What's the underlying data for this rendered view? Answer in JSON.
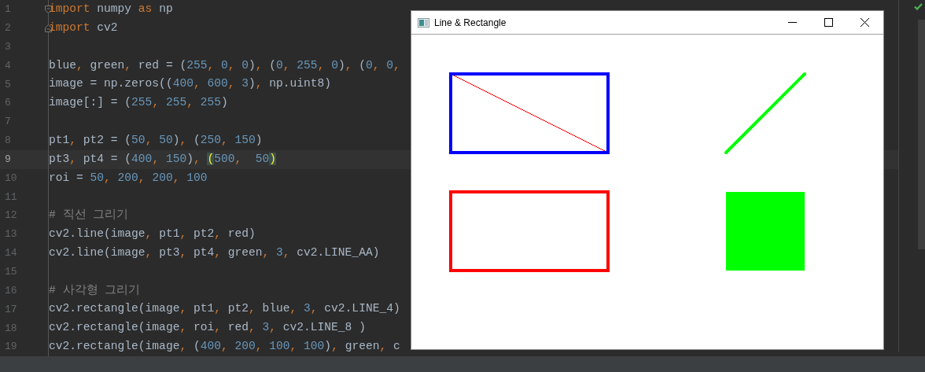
{
  "editor": {
    "lines": [
      {
        "number": "1",
        "fold_start": true,
        "tokens": [
          {
            "text": "import",
            "kind": "kw"
          },
          {
            "text": " numpy ",
            "kind": "p"
          },
          {
            "text": "as",
            "kind": "kw"
          },
          {
            "text": " np",
            "kind": "p"
          }
        ]
      },
      {
        "number": "2",
        "fold_end": true,
        "tokens": [
          {
            "text": "import",
            "kind": "kw"
          },
          {
            "text": " cv2",
            "kind": "p"
          }
        ]
      },
      {
        "number": "3"
      },
      {
        "number": "4",
        "tokens": [
          {
            "text": "blue",
            "kind": "p"
          },
          {
            "text": ", ",
            "kind": "op"
          },
          {
            "text": "green",
            "kind": "p"
          },
          {
            "text": ", ",
            "kind": "op"
          },
          {
            "text": "red = (",
            "kind": "p"
          },
          {
            "text": "255",
            "kind": "num"
          },
          {
            "text": ", ",
            "kind": "op"
          },
          {
            "text": "0",
            "kind": "num"
          },
          {
            "text": ", ",
            "kind": "op"
          },
          {
            "text": "0",
            "kind": "num"
          },
          {
            "text": ")",
            "kind": "p"
          },
          {
            "text": ", ",
            "kind": "op"
          },
          {
            "text": "(",
            "kind": "p"
          },
          {
            "text": "0",
            "kind": "num"
          },
          {
            "text": ", ",
            "kind": "op"
          },
          {
            "text": "255",
            "kind": "num"
          },
          {
            "text": ", ",
            "kind": "op"
          },
          {
            "text": "0",
            "kind": "num"
          },
          {
            "text": ")",
            "kind": "p"
          },
          {
            "text": ", ",
            "kind": "op"
          },
          {
            "text": "(",
            "kind": "p"
          },
          {
            "text": "0",
            "kind": "num"
          },
          {
            "text": ", ",
            "kind": "op"
          },
          {
            "text": "0",
            "kind": "num"
          },
          {
            "text": ",",
            "kind": "op"
          }
        ]
      },
      {
        "number": "5",
        "tokens": [
          {
            "text": "image = np.zeros((",
            "kind": "p"
          },
          {
            "text": "400",
            "kind": "num"
          },
          {
            "text": ", ",
            "kind": "op"
          },
          {
            "text": "600",
            "kind": "num"
          },
          {
            "text": ", ",
            "kind": "op"
          },
          {
            "text": "3",
            "kind": "num"
          },
          {
            "text": ")",
            "kind": "p"
          },
          {
            "text": ", ",
            "kind": "op"
          },
          {
            "text": "np.uint8)",
            "kind": "p"
          }
        ]
      },
      {
        "number": "6",
        "tokens": [
          {
            "text": "image[:] = (",
            "kind": "p"
          },
          {
            "text": "255",
            "kind": "num"
          },
          {
            "text": ", ",
            "kind": "op"
          },
          {
            "text": "255",
            "kind": "num"
          },
          {
            "text": ", ",
            "kind": "op"
          },
          {
            "text": "255",
            "kind": "num"
          },
          {
            "text": ")",
            "kind": "p"
          }
        ]
      },
      {
        "number": "7"
      },
      {
        "number": "8",
        "tokens": [
          {
            "text": "pt1",
            "kind": "p"
          },
          {
            "text": ", ",
            "kind": "op"
          },
          {
            "text": "pt2 = (",
            "kind": "p"
          },
          {
            "text": "50",
            "kind": "num"
          },
          {
            "text": ", ",
            "kind": "op"
          },
          {
            "text": "50",
            "kind": "num"
          },
          {
            "text": ")",
            "kind": "p"
          },
          {
            "text": ", ",
            "kind": "op"
          },
          {
            "text": "(",
            "kind": "p"
          },
          {
            "text": "250",
            "kind": "num"
          },
          {
            "text": ", ",
            "kind": "op"
          },
          {
            "text": "150",
            "kind": "num"
          },
          {
            "text": ")",
            "kind": "p"
          }
        ]
      },
      {
        "number": "9",
        "current": true,
        "tokens": [
          {
            "text": "pt3",
            "kind": "p"
          },
          {
            "text": ", ",
            "kind": "op"
          },
          {
            "text": "pt4 = (",
            "kind": "p"
          },
          {
            "text": "400",
            "kind": "num"
          },
          {
            "text": ", ",
            "kind": "op"
          },
          {
            "text": "150",
            "kind": "num"
          },
          {
            "text": ")",
            "kind": "p"
          },
          {
            "text": ", ",
            "kind": "op"
          },
          {
            "text": "(",
            "kind": "brace"
          },
          {
            "text": "500",
            "kind": "num"
          },
          {
            "text": ",  ",
            "kind": "op"
          },
          {
            "text": "50",
            "kind": "num"
          },
          {
            "text": ")",
            "kind": "brace"
          }
        ]
      },
      {
        "number": "10",
        "tokens": [
          {
            "text": "roi = ",
            "kind": "p"
          },
          {
            "text": "50",
            "kind": "num"
          },
          {
            "text": ", ",
            "kind": "op"
          },
          {
            "text": "200",
            "kind": "num"
          },
          {
            "text": ", ",
            "kind": "op"
          },
          {
            "text": "200",
            "kind": "num"
          },
          {
            "text": ", ",
            "kind": "op"
          },
          {
            "text": "100",
            "kind": "num"
          }
        ]
      },
      {
        "number": "11"
      },
      {
        "number": "12",
        "tokens": [
          {
            "text": "# 직선 그리기",
            "kind": "cm"
          }
        ]
      },
      {
        "number": "13",
        "tokens": [
          {
            "text": "cv2.line(image",
            "kind": "p"
          },
          {
            "text": ", ",
            "kind": "op"
          },
          {
            "text": "pt1",
            "kind": "p"
          },
          {
            "text": ", ",
            "kind": "op"
          },
          {
            "text": "pt2",
            "kind": "p"
          },
          {
            "text": ", ",
            "kind": "op"
          },
          {
            "text": "red)",
            "kind": "p"
          }
        ]
      },
      {
        "number": "14",
        "tokens": [
          {
            "text": "cv2.line(image",
            "kind": "p"
          },
          {
            "text": ", ",
            "kind": "op"
          },
          {
            "text": "pt3",
            "kind": "p"
          },
          {
            "text": ", ",
            "kind": "op"
          },
          {
            "text": "pt4",
            "kind": "p"
          },
          {
            "text": ", ",
            "kind": "op"
          },
          {
            "text": "green",
            "kind": "p"
          },
          {
            "text": ", ",
            "kind": "op"
          },
          {
            "text": "3",
            "kind": "num"
          },
          {
            "text": ", ",
            "kind": "op"
          },
          {
            "text": "cv2.LINE_AA)",
            "kind": "p"
          }
        ]
      },
      {
        "number": "15"
      },
      {
        "number": "16",
        "tokens": [
          {
            "text": "# 사각형 그리기",
            "kind": "cm"
          }
        ]
      },
      {
        "number": "17",
        "tokens": [
          {
            "text": "cv2.rectangle(image",
            "kind": "p"
          },
          {
            "text": ", ",
            "kind": "op"
          },
          {
            "text": "pt1",
            "kind": "p"
          },
          {
            "text": ", ",
            "kind": "op"
          },
          {
            "text": "pt2",
            "kind": "p"
          },
          {
            "text": ", ",
            "kind": "op"
          },
          {
            "text": "blue",
            "kind": "p"
          },
          {
            "text": ", ",
            "kind": "op"
          },
          {
            "text": "3",
            "kind": "num"
          },
          {
            "text": ", ",
            "kind": "op"
          },
          {
            "text": "cv2.LINE_4)",
            "kind": "p"
          }
        ]
      },
      {
        "number": "18",
        "tokens": [
          {
            "text": "cv2.rectangle(image",
            "kind": "p"
          },
          {
            "text": ", ",
            "kind": "op"
          },
          {
            "text": "roi",
            "kind": "p"
          },
          {
            "text": ", ",
            "kind": "op"
          },
          {
            "text": "red",
            "kind": "p"
          },
          {
            "text": ", ",
            "kind": "op"
          },
          {
            "text": "3",
            "kind": "num"
          },
          {
            "text": ", ",
            "kind": "op"
          },
          {
            "text": "cv2.LINE_8 )",
            "kind": "p"
          }
        ]
      },
      {
        "number": "19",
        "tokens": [
          {
            "text": "cv2.rectangle(image",
            "kind": "p"
          },
          {
            "text": ", ",
            "kind": "op"
          },
          {
            "text": "(",
            "kind": "p"
          },
          {
            "text": "400",
            "kind": "num"
          },
          {
            "text": ", ",
            "kind": "op"
          },
          {
            "text": "200",
            "kind": "num"
          },
          {
            "text": ", ",
            "kind": "op"
          },
          {
            "text": "100",
            "kind": "num"
          },
          {
            "text": ", ",
            "kind": "op"
          },
          {
            "text": "100",
            "kind": "num"
          },
          {
            "text": ")",
            "kind": "p"
          },
          {
            "text": ", ",
            "kind": "op"
          },
          {
            "text": "green",
            "kind": "p"
          },
          {
            "text": ", ",
            "kind": "op"
          },
          {
            "text": "c",
            "kind": "p"
          }
        ]
      }
    ]
  },
  "window": {
    "title": "Line & Rectangle",
    "shapes": [
      {
        "kind": "line",
        "color": "#ff0000"
      },
      {
        "kind": "rect_outline",
        "color": "#0000ff"
      },
      {
        "kind": "thick_line",
        "color": "#00ff00"
      },
      {
        "kind": "rect_outline_lower",
        "color": "#ff0000"
      },
      {
        "kind": "filled_square",
        "color": "#00ff00"
      }
    ]
  }
}
